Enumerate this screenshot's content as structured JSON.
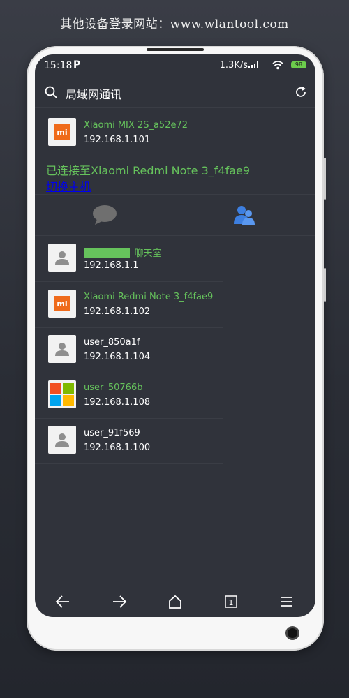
{
  "promo_text": "其他设备登录网站：www.wlantool.com",
  "status": {
    "time": "15:18",
    "p_icon": "P",
    "speed": "1.3K/s",
    "battery": "98"
  },
  "header": {
    "title": "局域网通讯"
  },
  "host": {
    "name": "Xiaomi MIX 2S_a52e72",
    "ip": "192.168.1.101",
    "icon": "mi-logo"
  },
  "connection": {
    "status": "已连接至Xiaomi Redmi Note 3_f4fae9",
    "switch_label": "切换主机"
  },
  "tabs": [
    {
      "icon": "chat-bubble-icon"
    },
    {
      "icon": "group-icon"
    }
  ],
  "devices": [
    {
      "name_suffix": "_聊天室",
      "ip": "192.168.1.1",
      "icon": "person-icon",
      "name_color": "#66c35c"
    },
    {
      "name": "Xiaomi Redmi Note 3_f4fae9",
      "ip": "192.168.1.102",
      "icon": "mi-logo",
      "name_color": "#66c35c"
    },
    {
      "name": "user_850a1f",
      "ip": "192.168.1.104",
      "icon": "person-icon",
      "name_color": "#ffffff"
    },
    {
      "name": "user_50766b",
      "ip": "192.168.1.108",
      "icon": "windows-logo",
      "name_color": "#66c35c"
    },
    {
      "name": "user_91f569",
      "ip": "192.168.1.100",
      "icon": "person-icon",
      "name_color": "#ffffff"
    }
  ],
  "bottom_nav": [
    "back-arrow-icon",
    "forward-arrow-icon",
    "home-icon",
    "tabs-count-icon",
    "menu-icon"
  ],
  "bottom_nav_tab_count": "1",
  "colors": {
    "accent_green": "#66c35c",
    "link_blue": "#0000ee",
    "screen_bg": "#30333b",
    "mi_orange": "#ef6a1a"
  }
}
